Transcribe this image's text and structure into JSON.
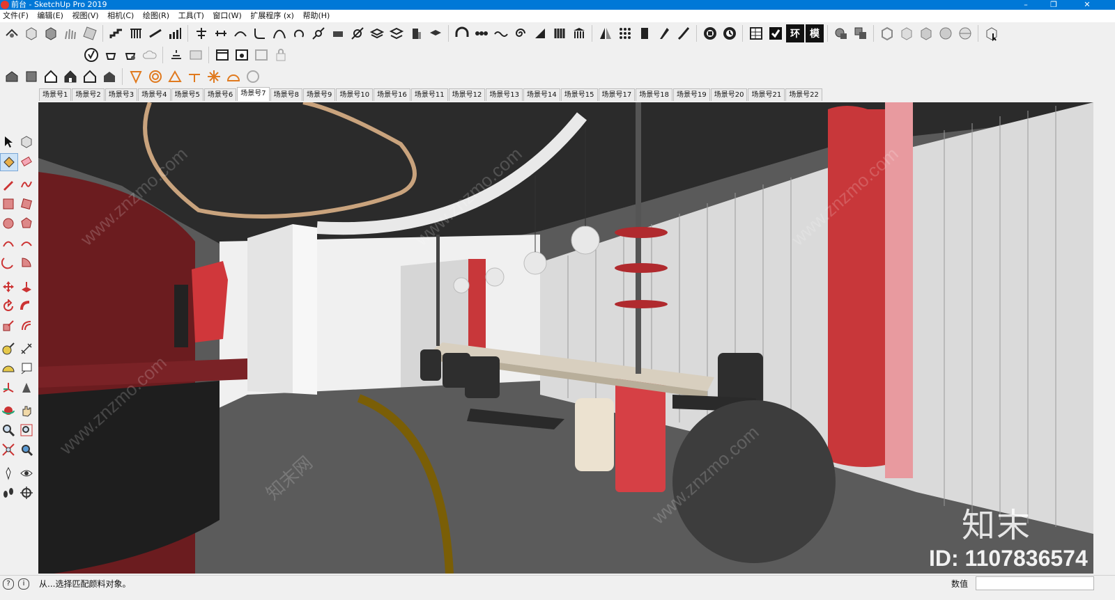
{
  "window": {
    "title": "前台 - SketchUp Pro 2019",
    "controls": {
      "minimize": "–",
      "maximize": "❐",
      "close": "✕"
    }
  },
  "menu": [
    "文件(F)",
    "编辑(E)",
    "视图(V)",
    "相机(C)",
    "绘图(R)",
    "工具(T)",
    "窗口(W)",
    "扩展程序 (x)",
    "帮助(H)"
  ],
  "scenes": [
    "场景号1",
    "场景号2",
    "场景号3",
    "场景号4",
    "场景号5",
    "场景号6",
    "场景号7",
    "场景号8",
    "场景号9",
    "场景号10",
    "场景号16",
    "场景号11",
    "场景号12",
    "场景号13",
    "场景号14",
    "场景号15",
    "场景号17",
    "场景号18",
    "场景号19",
    "场景号20",
    "场景号21",
    "场景号22"
  ],
  "active_scene": "场景号7",
  "toolbar_text_buttons": {
    "env": "环",
    "model": "模"
  },
  "status": {
    "message": "从...选择匹配颜料对象。",
    "vcb_label": "数值",
    "vcb_value": ""
  },
  "watermark": {
    "logo": "知末",
    "id": "ID: 1107836574",
    "site": "www.znzmo.com",
    "site_cn": "知末网"
  },
  "colors": {
    "titlebar": "#0078d7",
    "accent_red": "#c8373a",
    "floor": "#5d5d5d",
    "ceiling": "#2a2a2a"
  },
  "icons": {
    "left_tools": [
      "select-icon",
      "component-icon",
      "paint-bucket-icon",
      "eraser-icon",
      "pencil-icon",
      "freehand-icon",
      "rectangle-icon",
      "rotated-rectangle-icon",
      "circle-icon",
      "polygon-icon",
      "arc-icon",
      "two-point-arc-icon",
      "three-point-arc-icon",
      "pie-icon",
      "move-icon",
      "push-pull-icon",
      "rotate-icon",
      "follow-me-icon",
      "scale-icon",
      "offset-icon",
      "tape-measure-icon",
      "dimension-icon",
      "protractor-icon",
      "text-icon",
      "axes-icon",
      "3d-text-icon",
      "orbit-icon",
      "pan-icon",
      "zoom-icon",
      "zoom-window-icon",
      "zoom-extents-icon",
      "previous-view-icon",
      "position-camera-icon",
      "look-around-icon",
      "walk-icon",
      "section-plane-icon"
    ]
  }
}
